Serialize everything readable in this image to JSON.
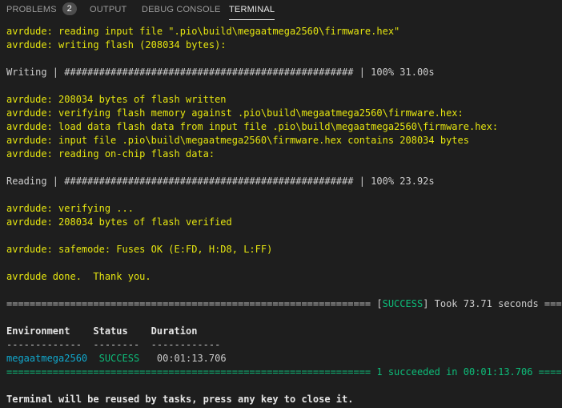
{
  "tabs": [
    {
      "label": "PROBLEMS",
      "badge": "2"
    },
    {
      "label": "OUTPUT"
    },
    {
      "label": "DEBUG CONSOLE"
    },
    {
      "label": "TERMINAL"
    }
  ],
  "terminal": {
    "lines": {
      "l1": "avrdude: reading input file \".pio\\build\\megaatmega2560\\firmware.hex\"",
      "l2": "avrdude: writing flash (208034 bytes):",
      "l3": "Writing | ################################################## | 100% 31.00s",
      "l4": "avrdude: 208034 bytes of flash written",
      "l5": "avrdude: verifying flash memory against .pio\\build\\megaatmega2560\\firmware.hex:",
      "l6": "avrdude: load data flash data from input file .pio\\build\\megaatmega2560\\firmware.hex:",
      "l7": "avrdude: input file .pio\\build\\megaatmega2560\\firmware.hex contains 208034 bytes",
      "l8": "avrdude: reading on-chip flash data:",
      "l9": "Reading | ################################################## | 100% 23.92s",
      "l10": "avrdude: verifying ...",
      "l11": "avrdude: 208034 bytes of flash verified",
      "l12": "avrdude: safemode: Fuses OK (E:FD, H:D8, L:FF)",
      "l13": "avrdude done.  Thank you."
    },
    "summary": {
      "sep_left": "=============================================================== [",
      "success_tag": "SUCCESS",
      "sep_right": "] Took 73.71 seconds ===",
      "header": "Environment    Status    Duration",
      "dashes": "-------------  --------  ------------",
      "env": "megaatmega2560",
      "status": "SUCCESS",
      "duration": "00:01:13.706",
      "final": "=============================================================== 1 succeeded in 00:01:13.706 ===="
    },
    "footer": "Terminal will be reused by tasks, press any key to close it."
  }
}
